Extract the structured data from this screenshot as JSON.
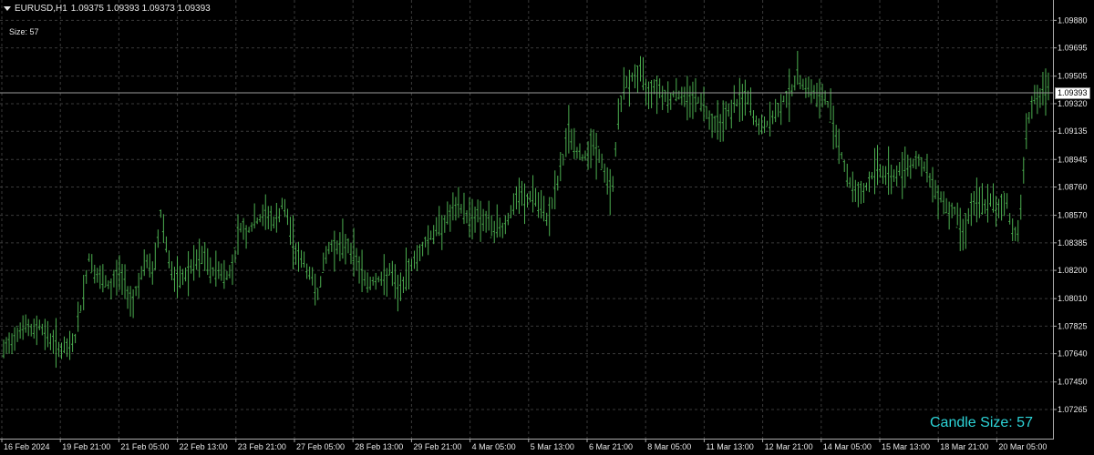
{
  "header": {
    "symbol": "EURUSD,H1",
    "ohlc": "1.09375 1.09393 1.09373 1.09393"
  },
  "size_label": "Size: 57",
  "candle_size_label": "Candle Size: 57",
  "current_price": "1.09393",
  "colors": {
    "background": "#000000",
    "grid": "#3a3a3a",
    "bars": "#4caf50",
    "candle_label": "#2dd4d8"
  },
  "chart_data": {
    "type": "line",
    "title": "EURUSD,H1",
    "ylim": [
      1.07265,
      1.09925
    ],
    "y_ticks": [
      "1.09880",
      "1.09695",
      "1.09505",
      "1.09320",
      "1.09135",
      "1.08945",
      "1.08760",
      "1.08570",
      "1.08385",
      "1.08200",
      "1.08010",
      "1.07825",
      "1.07640",
      "1.07450",
      "1.07265"
    ],
    "x_ticks": [
      "16 Feb 2024",
      "19 Feb 21:00",
      "21 Feb 05:00",
      "22 Feb 13:00",
      "23 Feb 21:00",
      "27 Feb 05:00",
      "28 Feb 13:00",
      "29 Feb 21:00",
      "4 Mar 05:00",
      "5 Mar 13:00",
      "6 Mar 21:00",
      "8 Mar 05:00",
      "11 Mar 13:00",
      "12 Mar 21:00",
      "14 Mar 05:00",
      "15 Mar 13:00",
      "18 Mar 21:00",
      "20 Mar 05:00"
    ],
    "series": [
      {
        "values": [
          1.0765,
          1.0772,
          1.078,
          1.0783,
          1.0778,
          1.0784,
          1.0776,
          1.0772,
          1.0767,
          1.0766,
          1.0775,
          1.08,
          1.083,
          1.0815,
          1.0812,
          1.0808,
          1.082,
          1.081,
          1.0798,
          1.0815,
          1.0825,
          1.0818,
          1.086,
          1.083,
          1.081,
          1.0815,
          1.082,
          1.0825,
          1.083,
          1.0818,
          1.0822,
          1.0815,
          1.0822,
          1.085,
          1.0845,
          1.0852,
          1.0855,
          1.0858,
          1.085,
          1.0865,
          1.0848,
          1.083,
          1.0825,
          1.0815,
          1.0805,
          1.083,
          1.0838,
          1.0835,
          1.0838,
          1.083,
          1.082,
          1.081,
          1.0815,
          1.0812,
          1.082,
          1.0805,
          1.0812,
          1.0825,
          1.083,
          1.084,
          1.0845,
          1.085,
          1.0855,
          1.086,
          1.0862,
          1.0855,
          1.0858,
          1.0855,
          1.085,
          1.0848,
          1.085,
          1.086,
          1.087,
          1.0865,
          1.0872,
          1.086,
          1.0855,
          1.087,
          1.089,
          1.0915,
          1.09,
          1.0895,
          1.0905,
          1.09,
          1.0885,
          1.087,
          1.093,
          1.0945,
          1.095,
          1.0952,
          1.094,
          1.0945,
          1.094,
          1.0935,
          1.094,
          1.0935,
          1.0938,
          1.0935,
          1.093,
          1.092,
          1.092,
          1.0925,
          1.093,
          1.0935,
          1.0935,
          1.092,
          1.0915,
          1.092,
          1.0925,
          1.0935,
          1.094,
          1.095,
          1.0945,
          1.094,
          1.0935,
          1.0935,
          1.092,
          1.09,
          1.088,
          1.0875,
          1.087,
          1.088,
          1.089,
          1.0885,
          1.0883,
          1.0885,
          1.089,
          1.0892,
          1.0895,
          1.0885,
          1.0875,
          1.087,
          1.086,
          1.086,
          1.0845,
          1.086,
          1.0865,
          1.0865,
          1.0865,
          1.086,
          1.087,
          1.0845,
          1.085,
          1.092,
          1.0935,
          1.0938,
          1.0939
        ]
      }
    ]
  }
}
